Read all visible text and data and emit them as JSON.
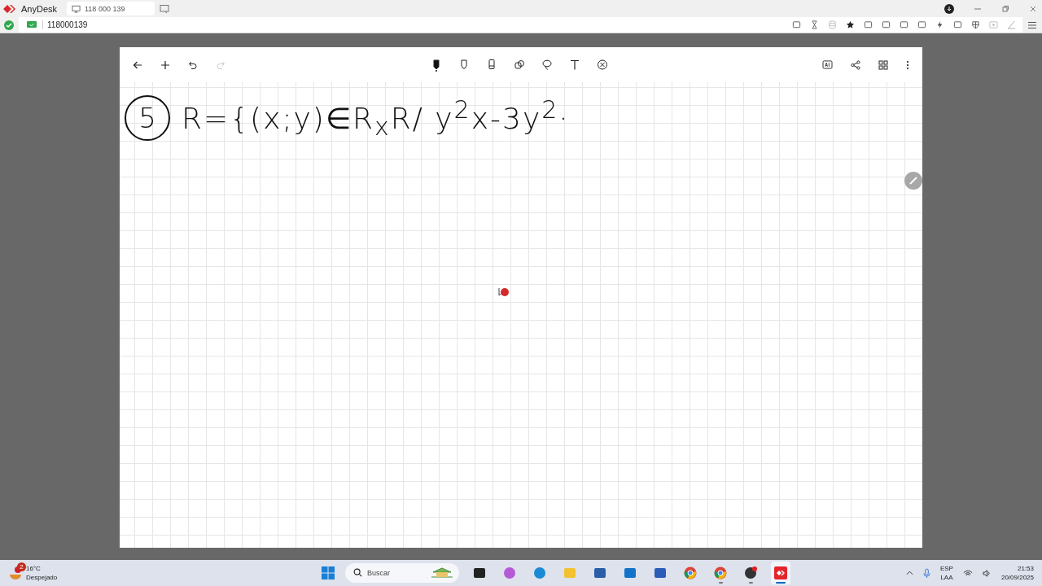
{
  "app": {
    "name": "AnyDesk"
  },
  "tabs": [
    {
      "label": "118 000 139",
      "selected": true
    }
  ],
  "address": {
    "value": "118000139"
  },
  "note_toolbar": {
    "redo_disabled": true,
    "tools": [
      {
        "kind": "pen",
        "selected": true
      },
      {
        "kind": "marker",
        "selected": false
      },
      {
        "kind": "eraser",
        "selected": false
      },
      {
        "kind": "shapes",
        "selected": false
      },
      {
        "kind": "lasso",
        "selected": false
      },
      {
        "kind": "text",
        "selected": false
      },
      {
        "kind": "ruler",
        "selected": false
      }
    ]
  },
  "note": {
    "number": "5",
    "formula": "R={(x;y)∈R$_{x}$R/ y$^{2}$x-3y$^{2}$·"
  },
  "taskbar": {
    "weather": {
      "badge": "2",
      "temperature": "16°C",
      "condition": "Despejado"
    },
    "search": {
      "placeholder": "Buscar"
    },
    "apps": [
      {
        "kind": "explorer-window",
        "running": false,
        "selected": false
      },
      {
        "kind": "copilot",
        "running": false,
        "selected": false
      },
      {
        "kind": "edge",
        "running": false,
        "selected": false
      },
      {
        "kind": "folder",
        "running": false,
        "selected": false
      },
      {
        "kind": "store",
        "running": false,
        "selected": false
      },
      {
        "kind": "outlook",
        "running": false,
        "selected": false
      },
      {
        "kind": "word",
        "running": false,
        "selected": false
      },
      {
        "kind": "chrome",
        "running": false,
        "selected": false
      },
      {
        "kind": "chrome",
        "running": true,
        "selected": false
      },
      {
        "kind": "recorder",
        "running": true,
        "selected": false
      },
      {
        "kind": "anydesk",
        "running": true,
        "selected": true
      }
    ],
    "language": "ESP",
    "layout": "LAA",
    "time": "21:53",
    "date": "20/09/2025"
  }
}
